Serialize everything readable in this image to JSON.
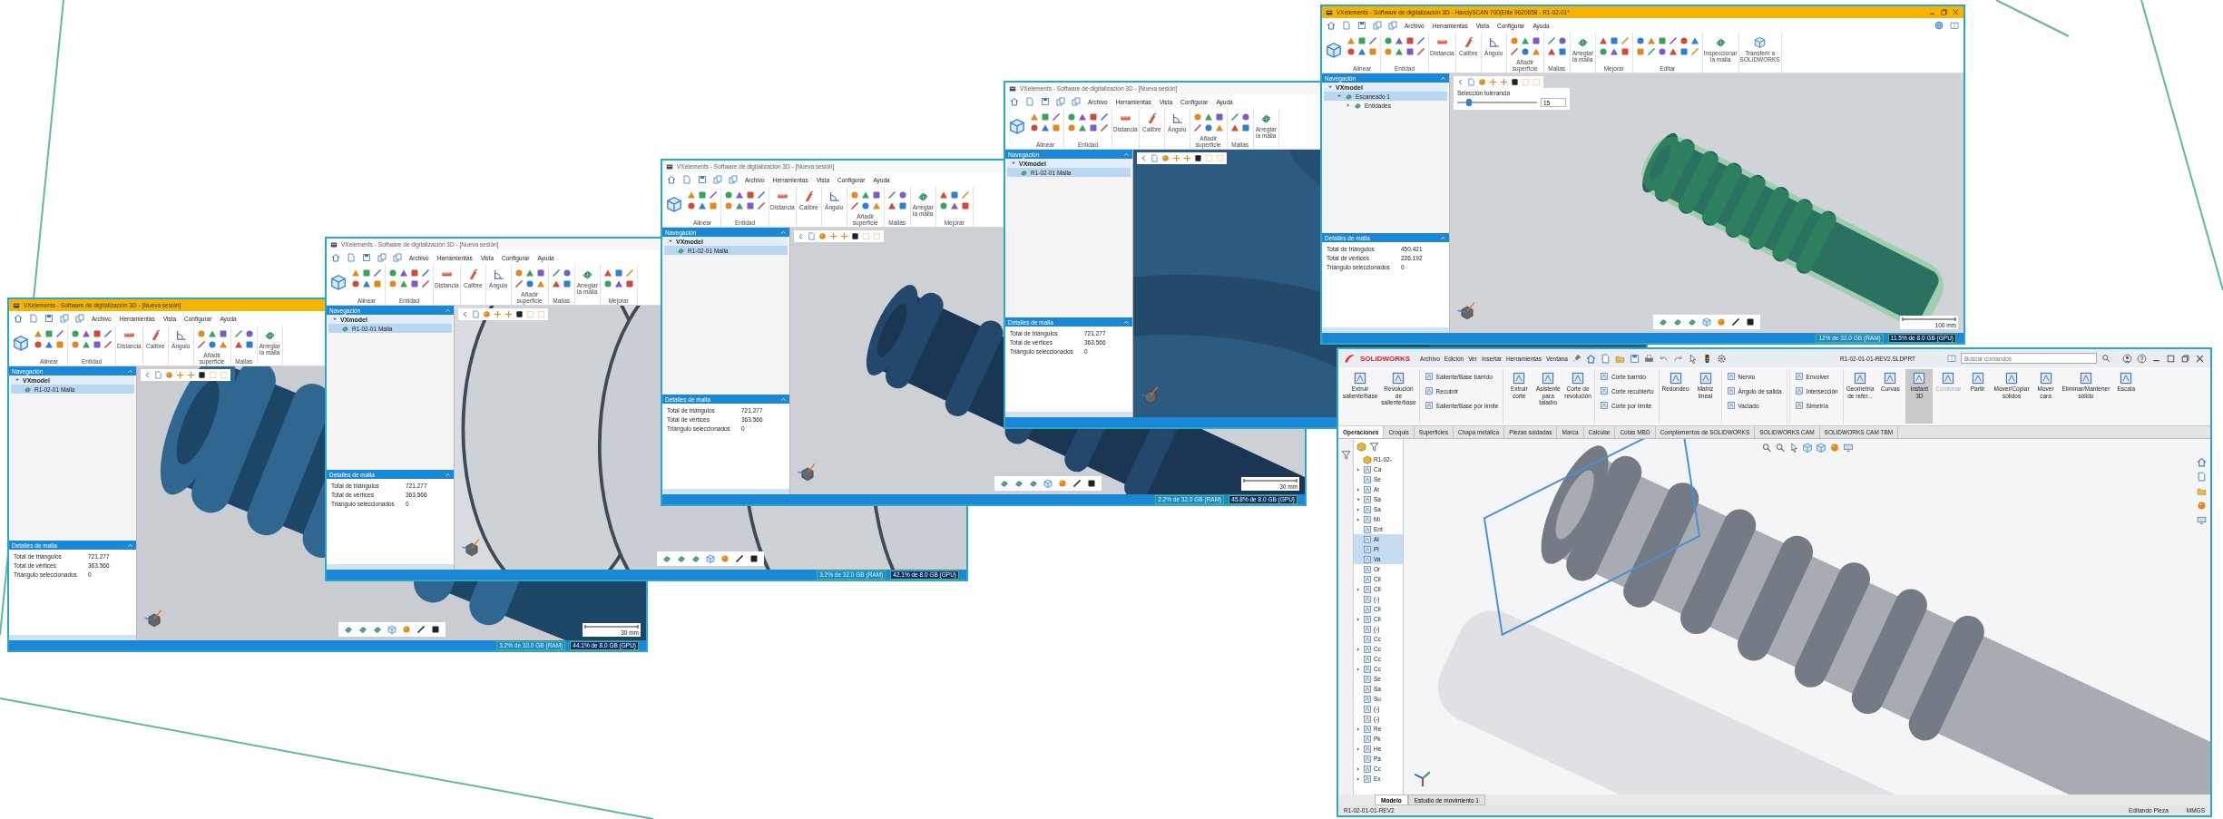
{
  "vx_windows": [
    {
      "title": "VXelements - Software de digitalización 3D - [Nueva sesión]",
      "active": true,
      "menu": [
        "Archivo",
        "Herramientas",
        "Vista",
        "Configurar",
        "Ayuda"
      ],
      "ribbon": [
        {
          "kind": "group",
          "label": "Alinear"
        },
        {
          "kind": "group",
          "label": "Entidad"
        },
        {
          "kind": "tool",
          "label": "Distancia"
        },
        {
          "kind": "tool",
          "label": "Calibre"
        },
        {
          "kind": "tool",
          "label": "Ángulo"
        },
        {
          "kind": "group",
          "label": "Añadir superficie"
        },
        {
          "kind": "group",
          "label": "Mallas"
        },
        {
          "kind": "tool",
          "label": "Arreglar la malla"
        }
      ],
      "navigation": {
        "title": "Navegación",
        "tree": [
          {
            "label": "VXmodel",
            "selected": false,
            "expanded": true,
            "children": [
              {
                "label": "R1-02-01 Malla",
                "selected": true
              }
            ]
          }
        ]
      },
      "details": {
        "title": "Detalles de malla",
        "rows": [
          {
            "label": "Total de triángulos",
            "value": "721.277"
          },
          {
            "label": "Total de vértices",
            "value": "363.566"
          },
          {
            "label": "Triángulo seleccionados",
            "value": "0"
          }
        ]
      },
      "bottom_toolbar": true,
      "scale_label": "30 mm",
      "status": [
        "3.2% de 32.0 GB (RAM)",
        "44.1% de 8.0 GB (GPU)"
      ]
    },
    {
      "title": "VXelements - Software de digitalización 3D - [Nueva sesión]",
      "active": false,
      "menu": [
        "Archivo",
        "Herramientas",
        "Vista",
        "Configurar",
        "Ayuda"
      ],
      "ribbon": [
        {
          "kind": "group",
          "label": "Alinear"
        },
        {
          "kind": "group",
          "label": "Entidad"
        },
        {
          "kind": "tool",
          "label": "Distancia"
        },
        {
          "kind": "tool",
          "label": "Calibre"
        },
        {
          "kind": "tool",
          "label": "Ángulo"
        },
        {
          "kind": "group",
          "label": "Añadir superficie"
        },
        {
          "kind": "group",
          "label": "Mallas"
        },
        {
          "kind": "tool",
          "label": "Arreglar la malla"
        },
        {
          "kind": "group",
          "label": "Mejorar"
        }
      ],
      "navigation": {
        "title": "Navegación",
        "tree": [
          {
            "label": "VXmodel",
            "selected": false,
            "expanded": true,
            "children": [
              {
                "label": "R1-02-01 Malla",
                "selected": true
              }
            ]
          }
        ]
      },
      "details": {
        "title": "Detalles de malla",
        "rows": [
          {
            "label": "Total de triángulos",
            "value": "721.277"
          },
          {
            "label": "Total de vértices",
            "value": "363.566"
          },
          {
            "label": "Triángulo seleccionados",
            "value": "0"
          }
        ]
      },
      "bottom_toolbar": true,
      "status": [
        "3.2% de 32.0 GB (RAM)",
        "42.1% de 8.0 GB (GPU)"
      ]
    },
    {
      "title": "VXelements - Software de digitalización 3D - [Nueva sesión]",
      "active": false,
      "menu": [
        "Archivo",
        "Herramientas",
        "Vista",
        "Configurar",
        "Ayuda"
      ],
      "ribbon": [
        {
          "kind": "group",
          "label": "Alinear"
        },
        {
          "kind": "group",
          "label": "Entidad"
        },
        {
          "kind": "tool",
          "label": "Distancia"
        },
        {
          "kind": "tool",
          "label": "Calibre"
        },
        {
          "kind": "tool",
          "label": "Ángulo"
        },
        {
          "kind": "group",
          "label": "Añadir superficie"
        },
        {
          "kind": "group",
          "label": "Mallas"
        },
        {
          "kind": "tool",
          "label": "Arreglar la malla"
        },
        {
          "kind": "group",
          "label": "Mejorar"
        }
      ],
      "navigation": {
        "title": "Navegación",
        "tree": [
          {
            "label": "VXmodel",
            "selected": false,
            "expanded": true,
            "children": [
              {
                "label": "R1-02-01 Malla",
                "selected": true
              }
            ]
          }
        ]
      },
      "details": {
        "title": "Detalles de malla",
        "rows": [
          {
            "label": "Total de triángulos",
            "value": "721.277"
          },
          {
            "label": "Total de vértices",
            "value": "363.566"
          },
          {
            "label": "Triángulo seleccionados",
            "value": "0"
          }
        ]
      },
      "bottom_toolbar": true,
      "scale_label": "30 mm",
      "status": [
        "2.2% de 32.0 GB (RAM)",
        "45.8% de 8.0 GB (GPU)"
      ]
    },
    {
      "title": "VXelements - Software de digitalización 3D - [Nueva sesión]",
      "active": false,
      "menu": [
        "Archivo",
        "Herramientas",
        "Vista",
        "Configurar",
        "Ayuda"
      ],
      "ribbon": [
        {
          "kind": "group",
          "label": "Alinear"
        },
        {
          "kind": "group",
          "label": "Entidad"
        },
        {
          "kind": "tool",
          "label": "Distancia"
        },
        {
          "kind": "tool",
          "label": "Calibre"
        },
        {
          "kind": "tool",
          "label": "Ángulo"
        },
        {
          "kind": "group",
          "label": "Añadir superficie"
        },
        {
          "kind": "group",
          "label": "Mallas"
        },
        {
          "kind": "tool",
          "label": "Arreglar la malla"
        }
      ],
      "navigation": {
        "title": "Navegación",
        "tree": [
          {
            "label": "VXmodel",
            "selected": false,
            "expanded": true,
            "children": [
              {
                "label": "R1-02-01 Malla",
                "selected": true
              }
            ]
          }
        ]
      },
      "details": {
        "title": "Detalles de malla",
        "rows": [
          {
            "label": "Total de triángulos",
            "value": "721.277"
          },
          {
            "label": "Total de vértices",
            "value": "363.566"
          },
          {
            "label": "Triángulo seleccionados",
            "value": "0"
          }
        ]
      }
    },
    {
      "title": "VXelements - Software de digitalización 3D - HandySCAN 700|Elite 9620658 - R1-02-01*",
      "active": true,
      "window_controls": true,
      "menu": [
        "Archivo",
        "Herramientas",
        "Vista",
        "Configurar",
        "Ayuda"
      ],
      "ribbon": [
        {
          "kind": "group",
          "label": "Alinear"
        },
        {
          "kind": "group",
          "label": "Entidad"
        },
        {
          "kind": "tool",
          "label": "Distancia"
        },
        {
          "kind": "tool",
          "label": "Calibre"
        },
        {
          "kind": "tool",
          "label": "Ángulo"
        },
        {
          "kind": "group",
          "label": "Añadir superficie"
        },
        {
          "kind": "group",
          "label": "Mallas"
        },
        {
          "kind": "tool",
          "label": "Arreglar la malla"
        },
        {
          "kind": "group",
          "label": "Mejorar"
        },
        {
          "kind": "group",
          "label": "Editar"
        },
        {
          "kind": "tool",
          "label": "Inspeccionar la malla"
        },
        {
          "kind": "tool",
          "label": "Transferir a SOLIDWORKS"
        }
      ],
      "navigation": {
        "title": "Navegación",
        "tree": [
          {
            "label": "VXmodel",
            "selected": false,
            "expanded": true,
            "children": [
              {
                "label": "Escaneado 1",
                "selected": true,
                "expanded": true,
                "children": [
                  {
                    "label": "Entidades",
                    "selected": false,
                    "expanded": false
                  }
                ]
              }
            ]
          }
        ]
      },
      "details": {
        "title": "Detalles de malla",
        "rows": [
          {
            "label": "Total de triángulos",
            "value": "450.421"
          },
          {
            "label": "Total de vértices",
            "value": "226.192"
          },
          {
            "label": "Triángulo seleccionados",
            "value": "0"
          }
        ]
      },
      "tolerance": {
        "label": "Selección tolerancia",
        "level": 0.15,
        "value": "15"
      },
      "bottom_toolbar": true,
      "scale_label": "100 mm",
      "status": [
        "12% de 32.0 GB (RAM)",
        "11.5% de 8.0 GB (GPU)"
      ]
    }
  ],
  "solidworks": {
    "logo": "SOLIDWORKS",
    "menu": [
      "Archivo",
      "Edición",
      "Ver",
      "Insertar",
      "Herramientas",
      "Ventana"
    ],
    "file_name": "R1-02-01-01-REV2.SLDPRT",
    "search": {
      "placeholder": "Buscar comandos"
    },
    "ribbon": [
      {
        "kind": "large",
        "label": "Extruir saliente/base",
        "on": false,
        "disabled": false
      },
      {
        "kind": "large",
        "label": "Revolución de saliente/base",
        "on": false,
        "disabled": false
      },
      {
        "kind": "stack",
        "items": [
          "Saliente/Base barrido",
          "Recubrir",
          "Saliente/Base por límite"
        ]
      },
      {
        "kind": "large",
        "label": "Extruir corte",
        "on": false,
        "disabled": false
      },
      {
        "kind": "large",
        "label": "Asistente para taladro",
        "on": false,
        "disabled": false
      },
      {
        "kind": "large",
        "label": "Corte de revolución",
        "on": false,
        "disabled": false
      },
      {
        "kind": "stack",
        "items": [
          "Corte barrido",
          "Corte recubierto",
          "Corte por límite"
        ]
      },
      {
        "kind": "large",
        "label": "Redondeo",
        "on": false,
        "disabled": false
      },
      {
        "kind": "large",
        "label": "Matriz lineal",
        "on": false,
        "disabled": false
      },
      {
        "kind": "stack",
        "items": [
          "Nervio",
          "Ángulo de salida",
          "Vaciado"
        ]
      },
      {
        "kind": "stack",
        "items": [
          "Envolver",
          "Intersección",
          "Simetría"
        ]
      },
      {
        "kind": "large",
        "label": "Geometría de refer...",
        "on": false,
        "disabled": false
      },
      {
        "kind": "large",
        "label": "Curvas",
        "on": false,
        "disabled": false
      },
      {
        "kind": "large",
        "label": "Instant 3D",
        "on": true,
        "disabled": false
      },
      {
        "kind": "large",
        "label": "Combinar",
        "on": false,
        "disabled": true
      },
      {
        "kind": "large",
        "label": "Partir",
        "on": false,
        "disabled": false
      },
      {
        "kind": "large",
        "label": "Mover/Copiar sólidos",
        "on": false,
        "disabled": false
      },
      {
        "kind": "large",
        "label": "Mover cara",
        "on": false,
        "disabled": false
      },
      {
        "kind": "large",
        "label": "Eliminar/Mantener sólido",
        "on": false,
        "disabled": false
      },
      {
        "kind": "large",
        "label": "Escala",
        "on": false,
        "disabled": false
      }
    ],
    "tabs": [
      {
        "label": "Operaciones",
        "selected": true
      },
      {
        "label": "Croquis",
        "selected": false
      },
      {
        "label": "Superficies",
        "selected": false
      },
      {
        "label": "Chapa metálica",
        "selected": false
      },
      {
        "label": "Piezas soldadas",
        "selected": false
      },
      {
        "label": "Marca",
        "selected": false
      },
      {
        "label": "Calcular",
        "selected": false
      },
      {
        "label": "Cotas MBD",
        "selected": false
      },
      {
        "label": "Complementos de SOLIDWORKS",
        "selected": false
      },
      {
        "label": "SOLIDWORKS CAM",
        "selected": false
      },
      {
        "label": "SOLIDWORKS CAM TBM",
        "selected": false
      }
    ],
    "tree": [
      {
        "label": "R1-02-",
        "selected": false
      },
      {
        "label": "Ca",
        "selected": false,
        "expanded": false
      },
      {
        "label": "Se",
        "selected": false
      },
      {
        "label": "Ar",
        "selected": false,
        "expanded": false
      },
      {
        "label": "Sa",
        "selected": false,
        "expanded": true
      },
      {
        "label": "Sa",
        "selected": false,
        "expanded": false
      },
      {
        "label": "Mi",
        "selected": false,
        "expanded": false
      },
      {
        "label": "Ent",
        "selected": false
      },
      {
        "label": "Al",
        "selected": true
      },
      {
        "label": "Pl",
        "selected": true
      },
      {
        "label": "Va",
        "selected": true
      },
      {
        "label": "Or",
        "selected": false
      },
      {
        "label": "Cil",
        "selected": false
      },
      {
        "label": "Cil",
        "selected": false,
        "expanded": false
      },
      {
        "label": "(-)",
        "selected": false
      },
      {
        "label": "Cil",
        "selected": false
      },
      {
        "label": "Cil",
        "selected": false,
        "expanded": false
      },
      {
        "label": "(-)",
        "selected": false
      },
      {
        "label": "Cc",
        "selected": false
      },
      {
        "label": "Cc",
        "selected": false,
        "expanded": false
      },
      {
        "label": "Cc",
        "selected": false
      },
      {
        "label": "Cc",
        "selected": false,
        "expanded": false
      },
      {
        "label": "Se",
        "selected": false
      },
      {
        "label": "Sa",
        "selected": false
      },
      {
        "label": "Su",
        "selected": false
      },
      {
        "label": "(-)",
        "selected": false
      },
      {
        "label": "(-)",
        "selected": false
      },
      {
        "label": "Re",
        "selected": false,
        "expanded": false
      },
      {
        "label": "Pk",
        "selected": false
      },
      {
        "label": "He",
        "selected": false,
        "expanded": false
      },
      {
        "label": "Pa",
        "selected": false
      },
      {
        "label": "Cc",
        "selected": false,
        "expanded": false
      },
      {
        "label": "Ex",
        "selected": false,
        "expanded": false
      }
    ],
    "model_tabs": [
      {
        "label": "Modelo",
        "selected": true
      },
      {
        "label": "Estudio de movimiento 1",
        "selected": false
      }
    ],
    "status_left": "R1-02-01-01-REV2",
    "status_right": [
      "Editando Pieza",
      "MMGS"
    ]
  }
}
